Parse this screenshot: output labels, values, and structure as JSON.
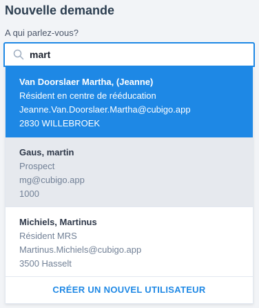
{
  "header": {
    "title": "Nouvelle demande",
    "question": "A qui parlez-vous?"
  },
  "search": {
    "value": "mart",
    "icon": "search-icon"
  },
  "results": [
    {
      "name": "Van Doorslaer Martha, (Jeanne)",
      "role": "Résident en centre de rééducation",
      "email": "Jeanne.Van.Doorslaer.Martha@cubigo.app",
      "location": "2830 WILLEBROEK",
      "state": "highlighted"
    },
    {
      "name": "Gaus, martin",
      "role": "Prospect",
      "email": "mg@cubigo.app",
      "location": "1000",
      "state": "hovered"
    },
    {
      "name": "Michiels, Martinus",
      "role": "Résident MRS",
      "email": "Martinus.Michiels@cubigo.app",
      "location": "3500 Hasselt",
      "state": "plain"
    }
  ],
  "create_user_label": "CRÉER UN NOUVEL UTILISATEUR",
  "colors": {
    "accent": "#1e88e5",
    "hover": "#e6e9ee",
    "background": "#f2f4f7"
  }
}
